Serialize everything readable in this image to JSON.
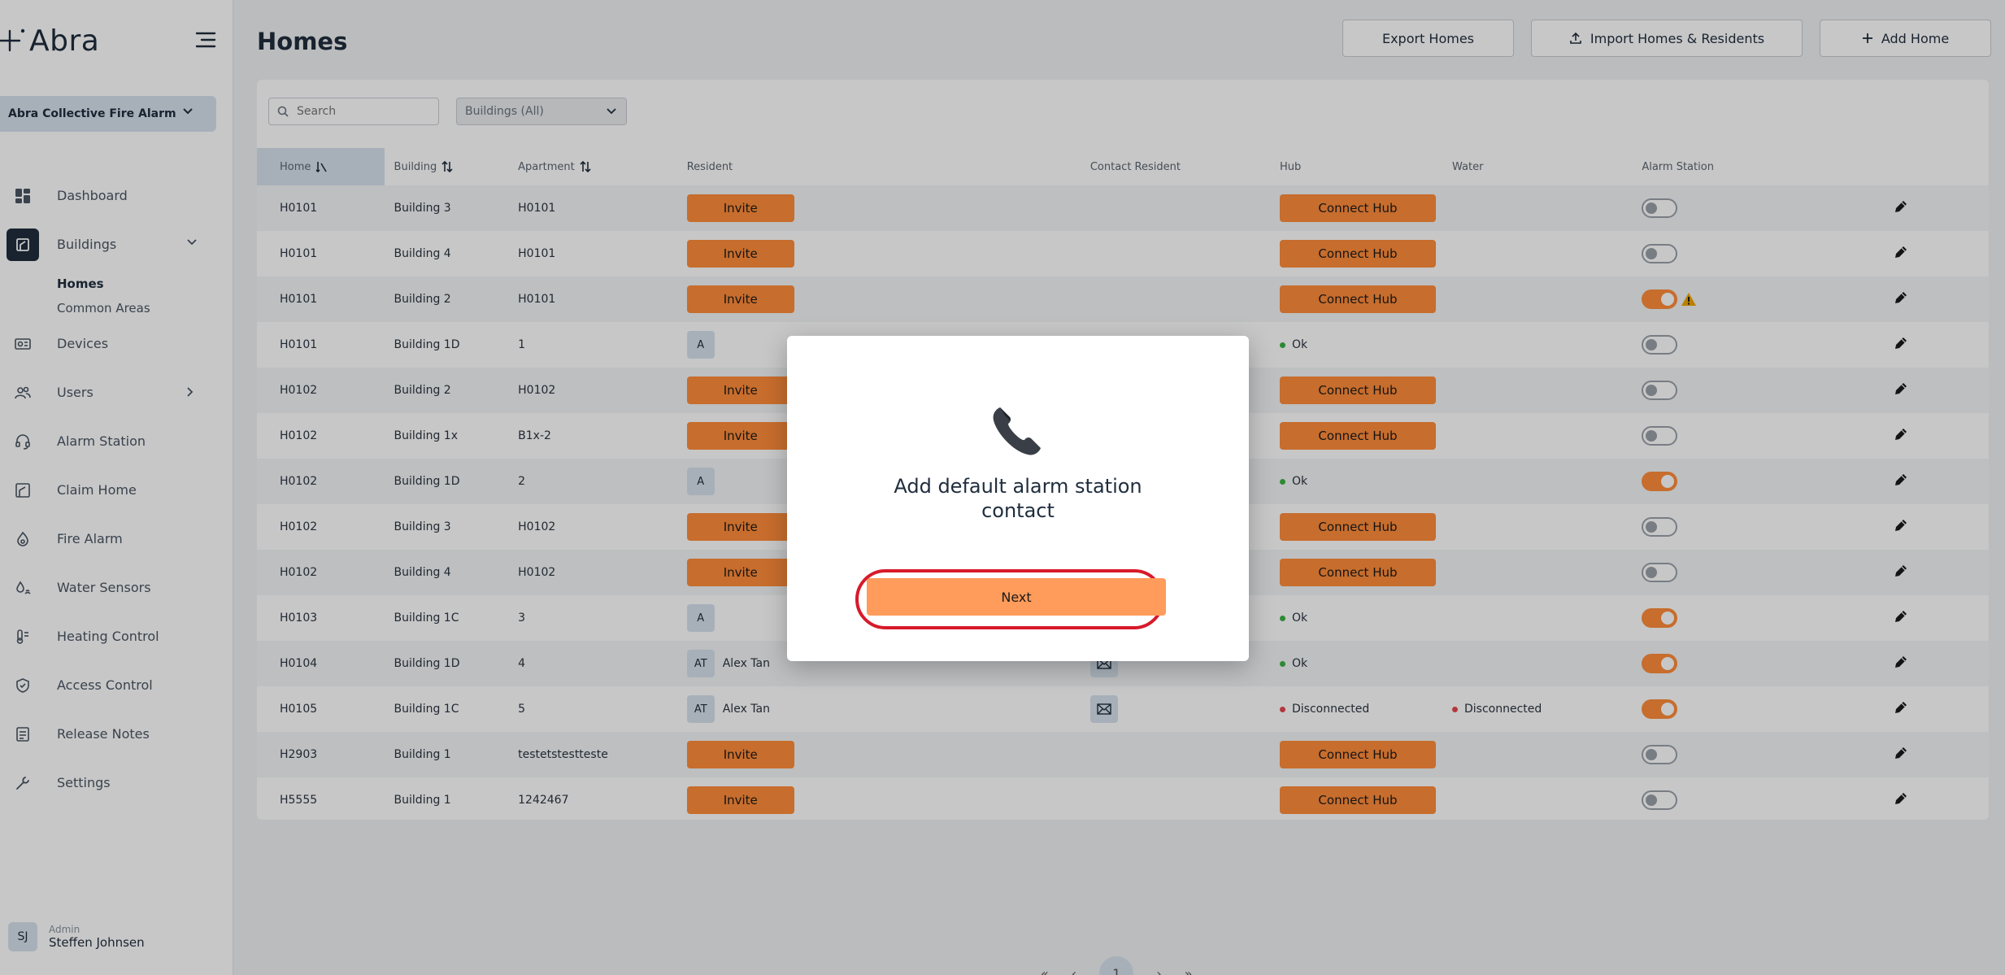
{
  "app": {
    "logo_text": "Abra"
  },
  "sidebar": {
    "org_name": "Abra Collective Fire Alarm",
    "items": [
      {
        "label": "Dashboard",
        "icon": "dashboard-icon"
      },
      {
        "label": "Buildings",
        "icon": "buildings-icon",
        "active": true
      },
      {
        "label": "Devices",
        "icon": "devices-icon"
      },
      {
        "label": "Users",
        "icon": "users-icon"
      },
      {
        "label": "Alarm Station",
        "icon": "headset-icon"
      },
      {
        "label": "Claim Home",
        "icon": "claim-home-icon"
      },
      {
        "label": "Fire Alarm",
        "icon": "fire-alarm-icon"
      },
      {
        "label": "Water Sensors",
        "icon": "water-sensor-icon"
      },
      {
        "label": "Heating Control",
        "icon": "heating-icon"
      },
      {
        "label": "Access Control",
        "icon": "shield-icon"
      },
      {
        "label": "Release Notes",
        "icon": "notes-icon"
      },
      {
        "label": "Settings",
        "icon": "wrench-icon"
      }
    ],
    "subitems": {
      "homes": "Homes",
      "common_areas": "Common Areas"
    },
    "user": {
      "initials": "SJ",
      "role": "Admin",
      "name": "Steffen Johnsen"
    }
  },
  "header": {
    "title": "Homes",
    "export_label": "Export Homes",
    "import_label": "Import Homes & Residents",
    "add_label": "Add Home"
  },
  "filters": {
    "search_placeholder": "Search",
    "building_select": "Buildings (All)"
  },
  "table": {
    "columns": {
      "home": "Home",
      "building": "Building",
      "apartment": "Apartment",
      "resident": "Resident",
      "contact": "Contact Resident",
      "hub": "Hub",
      "water": "Water",
      "alarm": "Alarm Station"
    },
    "invite_label": "Invite",
    "connect_hub_label": "Connect Hub",
    "rows": [
      {
        "home": "H0101",
        "building": "Building 3",
        "apartment": "H0101",
        "resident": "invite",
        "hub": "connect",
        "water": "",
        "alarm": false,
        "warn": false
      },
      {
        "home": "H0101",
        "building": "Building 4",
        "apartment": "H0101",
        "resident": "invite",
        "hub": "connect",
        "water": "",
        "alarm": false,
        "warn": false
      },
      {
        "home": "H0101",
        "building": "Building 2",
        "apartment": "H0101",
        "resident": "invite",
        "hub": "connect",
        "water": "",
        "alarm": true,
        "warn": true
      },
      {
        "home": "H0101",
        "building": "Building 1D",
        "apartment": "1",
        "resident": "avatar",
        "initials": "A",
        "hub": "Ok",
        "hub_color": "#3cb043",
        "water": "",
        "alarm": false,
        "warn": false
      },
      {
        "home": "H0102",
        "building": "Building 2",
        "apartment": "H0102",
        "resident": "invite",
        "hub": "connect",
        "water": "",
        "alarm": false,
        "warn": false
      },
      {
        "home": "H0102",
        "building": "Building 1x",
        "apartment": "B1x-2",
        "resident": "invite",
        "hub": "connect",
        "water": "",
        "alarm": false,
        "warn": false
      },
      {
        "home": "H0102",
        "building": "Building 1D",
        "apartment": "2",
        "resident": "avatar",
        "initials": "A",
        "hub": "Ok",
        "hub_color": "#3cb043",
        "water": "",
        "alarm": true,
        "warn": false
      },
      {
        "home": "H0102",
        "building": "Building 3",
        "apartment": "H0102",
        "resident": "invite",
        "hub": "connect",
        "water": "",
        "alarm": false,
        "warn": false
      },
      {
        "home": "H0102",
        "building": "Building 4",
        "apartment": "H0102",
        "resident": "invite",
        "hub": "connect",
        "water": "",
        "alarm": false,
        "warn": false
      },
      {
        "home": "H0103",
        "building": "Building 1C",
        "apartment": "3",
        "resident": "avatar",
        "initials": "A",
        "hub": "Ok",
        "hub_color": "#3cb043",
        "water": "",
        "alarm": true,
        "warn": false
      },
      {
        "home": "H0104",
        "building": "Building 1D",
        "apartment": "4",
        "resident": "avatar",
        "initials": "AT",
        "name": "Alex Tan",
        "contact": true,
        "hub": "Ok",
        "hub_color": "#3cb043",
        "water": "",
        "alarm": true,
        "warn": false
      },
      {
        "home": "H0105",
        "building": "Building 1C",
        "apartment": "5",
        "resident": "avatar",
        "initials": "AT",
        "name": "Alex Tan",
        "contact": true,
        "hub": "Disconnected",
        "hub_color": "#e5484d",
        "water": "Disconnected",
        "water_color": "#e5484d",
        "alarm": true,
        "warn": false
      },
      {
        "home": "H2903",
        "building": "Building 1",
        "apartment": "testetstestteste",
        "resident": "invite",
        "hub": "connect",
        "water": "",
        "alarm": false,
        "warn": false
      },
      {
        "home": "H5555",
        "building": "Building 1",
        "apartment": "1242467",
        "resident": "invite",
        "hub": "connect",
        "water": "",
        "alarm": false,
        "warn": false
      }
    ]
  },
  "pagination": {
    "first": "«",
    "prev": "‹",
    "current": "1",
    "next": "›",
    "last": "»"
  },
  "modal": {
    "title": "Add default alarm station contact",
    "next_label": "Next",
    "icon": "telephone-icon"
  },
  "colors": {
    "accent": "#ff8c3a",
    "navy": "#1f2d3d",
    "highlight": "#d71a2a"
  }
}
